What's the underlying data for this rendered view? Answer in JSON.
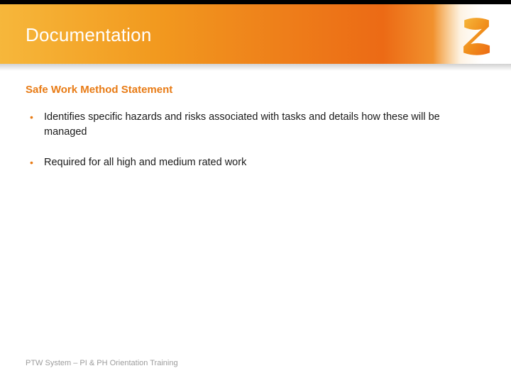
{
  "header": {
    "title": "Documentation"
  },
  "content": {
    "subheading": "Safe Work Method Statement",
    "bullets": [
      "Identifies specific hazards and risks associated with tasks and details how these will be managed",
      "Required for all high and medium rated work"
    ]
  },
  "footer": {
    "text": "PTW System –  PI & PH Orientation Training"
  }
}
